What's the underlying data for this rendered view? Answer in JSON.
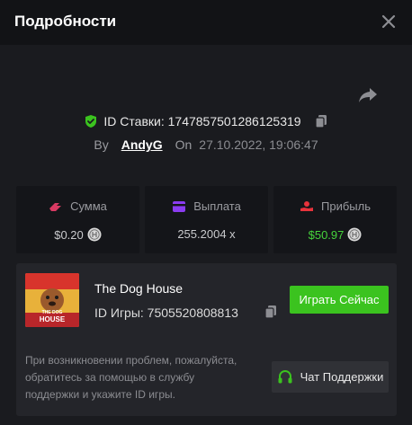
{
  "header": {
    "title": "Подробности"
  },
  "bet": {
    "id_label": "ID Ставки: 1747857501286125319",
    "by_label": "By",
    "user": "AndyG",
    "on_label": "On",
    "datetime": "27.10.2022, 19:06:47"
  },
  "stats": [
    {
      "label": "Сумма",
      "value": "$0.20",
      "icon": "bet-amount-icon",
      "icon_color": "#d83a63"
    },
    {
      "label": "Выплата",
      "value": "255.2004 x",
      "icon": "payout-card-icon",
      "icon_color": "#8b3cf0"
    },
    {
      "label": "Прибыль",
      "value": "$50.97",
      "icon": "profit-hand-icon",
      "icon_color": "#e8333c",
      "value_color": "#46d33c"
    }
  ],
  "game": {
    "name": "The Dog House",
    "id_label": "ID Игры: 7505520808813",
    "play_label": "Играть Сейчас",
    "thumb_text_top": "THE DOG",
    "thumb_text_bottom": "HOUSE"
  },
  "support": {
    "help_text": "При возникновении проблем, пожалуйста, обратитесь за помощью в службу поддержки и укажите ID игры.",
    "button_label": "Чат Поддержки"
  },
  "colors": {
    "accent_green": "#3bc31f",
    "profit_green": "#46d33c"
  }
}
